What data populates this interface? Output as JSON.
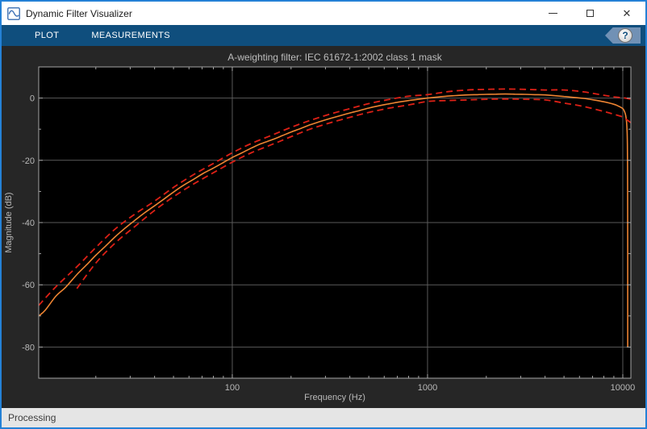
{
  "window": {
    "title": "Dynamic Filter Visualizer",
    "controls": {
      "minimize": "minimize",
      "maximize": "maximize",
      "close": "✕"
    }
  },
  "toolbar": {
    "tabs": [
      {
        "label": "PLOT"
      },
      {
        "label": "MEASUREMENTS"
      }
    ],
    "help_label": "?"
  },
  "statusbar": {
    "text": "Processing"
  },
  "colors": {
    "window_border": "#2481d6",
    "titlebar_bg": "#ffffff",
    "toolbar_bg": "#0f4e7d",
    "help_chevron": "#7191b5",
    "panel_bg": "#262626",
    "axes_bg": "#000000",
    "grid": "#5a5a5a",
    "axis_frame": "#a6a6a6",
    "tick_label": "#b9b9b9",
    "chart_title": "#bdbdbd",
    "response_line": "#ee8432",
    "mask_line": "#dd2016",
    "status_bg": "#e5e5e5"
  },
  "chart_data": {
    "type": "line",
    "title": "A-weighting filter: IEC 61672-1:2002 class 1 mask",
    "xlabel": "Frequency (Hz)",
    "ylabel": "Magnitude (dB)",
    "x_scale": "log",
    "xlim": [
      10.2,
      11000
    ],
    "ylim": [
      -90,
      10
    ],
    "grid": true,
    "legend": "none",
    "xticks": [
      {
        "value": 100,
        "label": "100"
      },
      {
        "value": 1000,
        "label": "1000"
      },
      {
        "value": 10000,
        "label": "10000"
      }
    ],
    "yticks": [
      {
        "value": 0,
        "label": "0"
      },
      {
        "value": -20,
        "label": "-20"
      },
      {
        "value": -40,
        "label": "-40"
      },
      {
        "value": -60,
        "label": "-60"
      },
      {
        "value": -80,
        "label": "-80"
      }
    ],
    "x_minor_ticks": [
      20,
      30,
      40,
      50,
      60,
      70,
      80,
      90,
      200,
      300,
      400,
      500,
      600,
      700,
      800,
      900,
      2000,
      3000,
      4000,
      5000,
      6000,
      7000,
      8000,
      9000
    ],
    "y_minor_ticks": [
      -10,
      -30,
      -50,
      -70
    ],
    "series": [
      {
        "name": "a-weighting-filter-response",
        "color": "#ee8432",
        "style": "solid",
        "width": 1.6,
        "points": [
          [
            10.2,
            -70.0
          ],
          [
            11,
            -68.2
          ],
          [
            12.5,
            -63.6
          ],
          [
            14,
            -60.8
          ],
          [
            16,
            -56.7
          ],
          [
            18,
            -53.5
          ],
          [
            20,
            -50.5
          ],
          [
            22.4,
            -47.6
          ],
          [
            25,
            -44.7
          ],
          [
            28,
            -42.0
          ],
          [
            31.5,
            -39.4
          ],
          [
            35.5,
            -36.9
          ],
          [
            40,
            -34.6
          ],
          [
            45,
            -32.3
          ],
          [
            50,
            -30.2
          ],
          [
            56,
            -28.1
          ],
          [
            63,
            -26.2
          ],
          [
            71,
            -24.2
          ],
          [
            80,
            -22.5
          ],
          [
            90,
            -20.7
          ],
          [
            100,
            -19.1
          ],
          [
            112,
            -17.6
          ],
          [
            125,
            -16.1
          ],
          [
            140,
            -14.7
          ],
          [
            160,
            -13.4
          ],
          [
            180,
            -12.1
          ],
          [
            200,
            -10.9
          ],
          [
            224,
            -9.8
          ],
          [
            250,
            -8.6
          ],
          [
            280,
            -7.6
          ],
          [
            315,
            -6.6
          ],
          [
            355,
            -5.7
          ],
          [
            400,
            -4.8
          ],
          [
            450,
            -4.0
          ],
          [
            500,
            -3.2
          ],
          [
            560,
            -2.5
          ],
          [
            630,
            -1.9
          ],
          [
            710,
            -1.3
          ],
          [
            800,
            -0.8
          ],
          [
            900,
            -0.4
          ],
          [
            1000,
            0.0
          ],
          [
            1120,
            0.3
          ],
          [
            1250,
            0.6
          ],
          [
            1400,
            0.8
          ],
          [
            1600,
            1.0
          ],
          [
            1800,
            1.1
          ],
          [
            2000,
            1.2
          ],
          [
            2240,
            1.25
          ],
          [
            2500,
            1.3
          ],
          [
            2800,
            1.25
          ],
          [
            3150,
            1.2
          ],
          [
            3550,
            1.1
          ],
          [
            4000,
            1.0
          ],
          [
            4500,
            0.75
          ],
          [
            5000,
            0.5
          ],
          [
            5600,
            0.2
          ],
          [
            6300,
            -0.1
          ],
          [
            7100,
            -0.6
          ],
          [
            8000,
            -1.2
          ],
          [
            9000,
            -2.0
          ],
          [
            9500,
            -2.6
          ],
          [
            10000,
            -3.4
          ],
          [
            10200,
            -4.3
          ],
          [
            10350,
            -5.6
          ],
          [
            10450,
            -7.5
          ],
          [
            10520,
            -10.5
          ],
          [
            10560,
            -15
          ],
          [
            10580,
            -22
          ],
          [
            10590,
            -32
          ],
          [
            10597,
            -48
          ],
          [
            10600,
            -80
          ]
        ]
      },
      {
        "name": "mask-upper-limit",
        "color": "#dd2016",
        "style": "dashed",
        "width": 1.8,
        "points": [
          [
            10.2,
            -66.6
          ],
          [
            12.5,
            -60.6
          ],
          [
            16,
            -54.2
          ],
          [
            20,
            -48.0
          ],
          [
            25,
            -42.2
          ],
          [
            31.5,
            -37.4
          ],
          [
            40,
            -33.1
          ],
          [
            50,
            -28.7
          ],
          [
            63,
            -24.7
          ],
          [
            80,
            -21.0
          ],
          [
            100,
            -17.6
          ],
          [
            125,
            -14.6
          ],
          [
            160,
            -11.9
          ],
          [
            200,
            -9.4
          ],
          [
            250,
            -7.2
          ],
          [
            315,
            -5.2
          ],
          [
            400,
            -3.4
          ],
          [
            500,
            -1.8
          ],
          [
            630,
            -0.5
          ],
          [
            800,
            0.6
          ],
          [
            1000,
            1.1
          ],
          [
            1250,
            2.0
          ],
          [
            1600,
            2.6
          ],
          [
            2000,
            2.8
          ],
          [
            2500,
            2.9
          ],
          [
            3150,
            2.8
          ],
          [
            4000,
            2.6
          ],
          [
            5000,
            2.6
          ],
          [
            6300,
            2.0
          ],
          [
            8000,
            0.9
          ],
          [
            9000,
            0.4
          ],
          [
            10000,
            0.1
          ],
          [
            10500,
            -0.1
          ],
          [
            11000,
            -0.4
          ]
        ]
      },
      {
        "name": "mask-lower-limit",
        "color": "#dd2016",
        "style": "dashed",
        "width": 1.8,
        "points": [
          [
            16,
            -61.2
          ],
          [
            20,
            -53.0
          ],
          [
            25,
            -46.7
          ],
          [
            31.5,
            -41.4
          ],
          [
            40,
            -36.1
          ],
          [
            50,
            -31.7
          ],
          [
            63,
            -27.7
          ],
          [
            80,
            -24.0
          ],
          [
            100,
            -20.6
          ],
          [
            125,
            -17.6
          ],
          [
            160,
            -14.9
          ],
          [
            200,
            -12.4
          ],
          [
            250,
            -10.0
          ],
          [
            315,
            -8.0
          ],
          [
            400,
            -6.2
          ],
          [
            500,
            -4.6
          ],
          [
            630,
            -3.3
          ],
          [
            800,
            -2.2
          ],
          [
            1000,
            -1.1
          ],
          [
            1250,
            -0.8
          ],
          [
            1600,
            -0.6
          ],
          [
            2000,
            -0.4
          ],
          [
            2500,
            -0.3
          ],
          [
            3150,
            -0.4
          ],
          [
            4000,
            -0.6
          ],
          [
            5000,
            -1.6
          ],
          [
            6300,
            -2.7
          ],
          [
            8000,
            -4.3
          ],
          [
            9000,
            -5.2
          ],
          [
            10000,
            -6.1
          ],
          [
            10500,
            -7.0
          ],
          [
            11000,
            -7.9
          ]
        ]
      }
    ]
  }
}
